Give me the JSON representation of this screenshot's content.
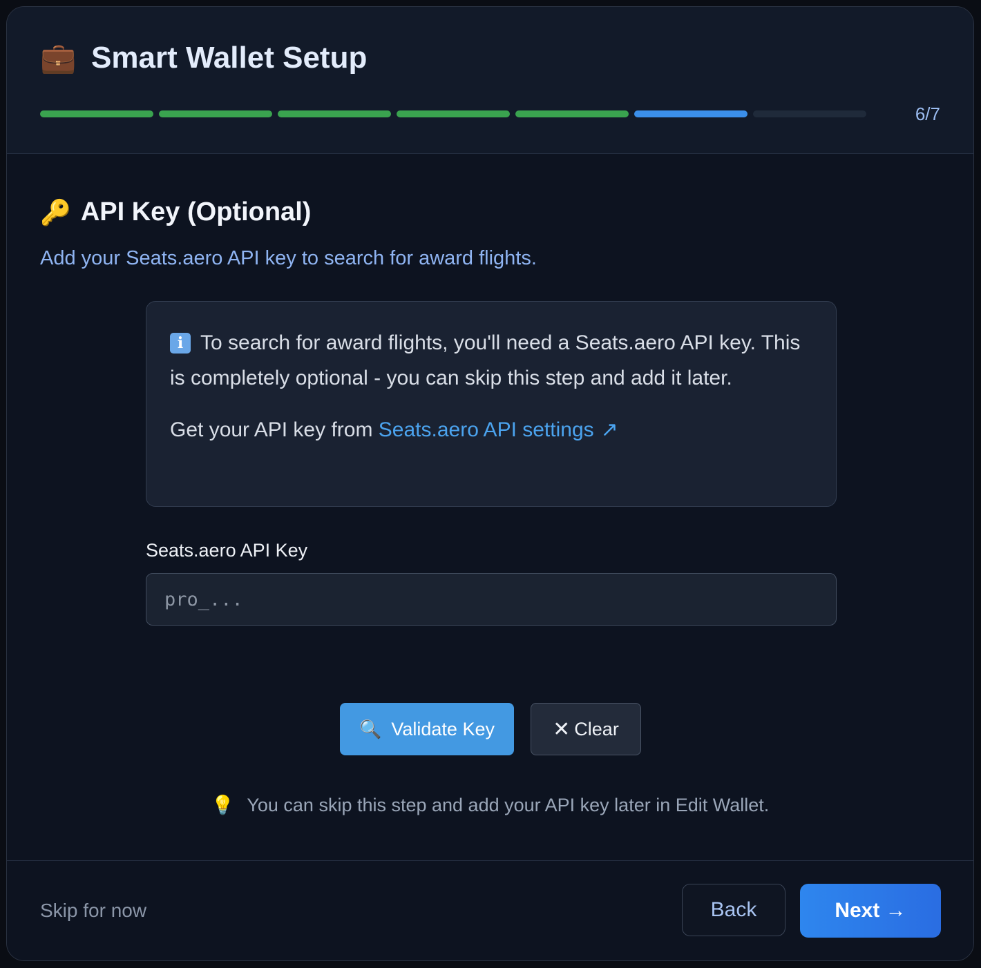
{
  "header": {
    "icon": "briefcase-icon",
    "title": "Smart Wallet Setup",
    "progress": {
      "current_step": 6,
      "total_steps": 7,
      "label": "6/7"
    }
  },
  "step": {
    "icon": "key-icon",
    "title": "API Key (Optional)",
    "subtitle": "Add your Seats.aero API key to search for award flights."
  },
  "info_box": {
    "icon": "info-icon",
    "text": "To search for award flights, you'll need a Seats.aero API key. This is completely optional - you can skip this step and add it later.",
    "link_prefix": "Get your API key from",
    "link_text": "Seats.aero API settings",
    "link_icon": "external-link-icon"
  },
  "api_key_field": {
    "label": "Seats.aero API Key",
    "value": "",
    "placeholder": "pro_..."
  },
  "actions": {
    "validate_icon": "magnifier-icon",
    "validate_label": "Validate Key",
    "clear_icon": "close-icon",
    "clear_label": "Clear"
  },
  "hint": {
    "icon": "lightbulb-icon",
    "text": "You can skip this step and add your API key later in Edit Wallet."
  },
  "footer": {
    "skip_label": "Skip for now",
    "back_label": "Back",
    "next_label": "Next →"
  },
  "colors": {
    "background": "#0d1320",
    "accent_blue": "#3b8fea",
    "progress_done": "#3aa34f",
    "progress_pending": "#1f2a3a",
    "link": "#4ba3ee"
  }
}
